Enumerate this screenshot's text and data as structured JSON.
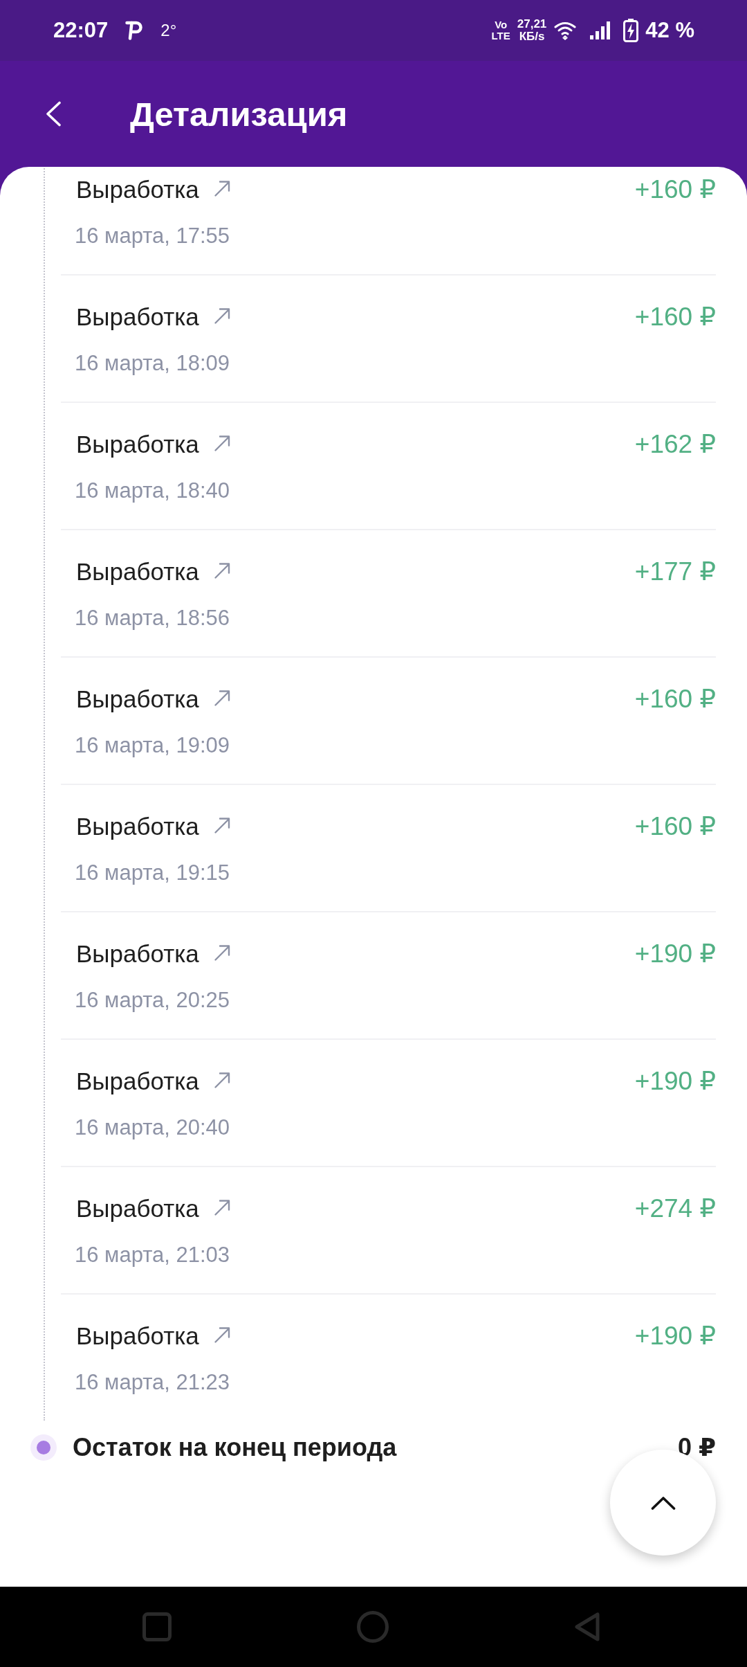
{
  "status_bar": {
    "time": "22:07",
    "temperature": "2°",
    "volte": [
      "Vo",
      "LTE"
    ],
    "speed": [
      "27,21",
      "КБ/s"
    ],
    "charging": true,
    "battery": "42 %"
  },
  "header": {
    "title": "Детализация"
  },
  "transactions": [
    {
      "title": "Выработка",
      "date": "16 марта, 17:55",
      "amount": "+160 ₽"
    },
    {
      "title": "Выработка",
      "date": "16 марта, 18:09",
      "amount": "+160 ₽"
    },
    {
      "title": "Выработка",
      "date": "16 марта, 18:40",
      "amount": "+162 ₽"
    },
    {
      "title": "Выработка",
      "date": "16 марта, 18:56",
      "amount": "+177 ₽"
    },
    {
      "title": "Выработка",
      "date": "16 марта, 19:09",
      "amount": "+160 ₽"
    },
    {
      "title": "Выработка",
      "date": "16 марта, 19:15",
      "amount": "+160 ₽"
    },
    {
      "title": "Выработка",
      "date": "16 марта, 20:25",
      "amount": "+190 ₽"
    },
    {
      "title": "Выработка",
      "date": "16 марта, 20:40",
      "amount": "+190 ₽"
    },
    {
      "title": "Выработка",
      "date": "16 марта, 21:03",
      "amount": "+274 ₽"
    },
    {
      "title": "Выработка",
      "date": "16 марта, 21:23",
      "amount": "+190 ₽"
    }
  ],
  "closing_balance": {
    "label": "Остаток на конец периода",
    "amount": "0 ₽"
  }
}
